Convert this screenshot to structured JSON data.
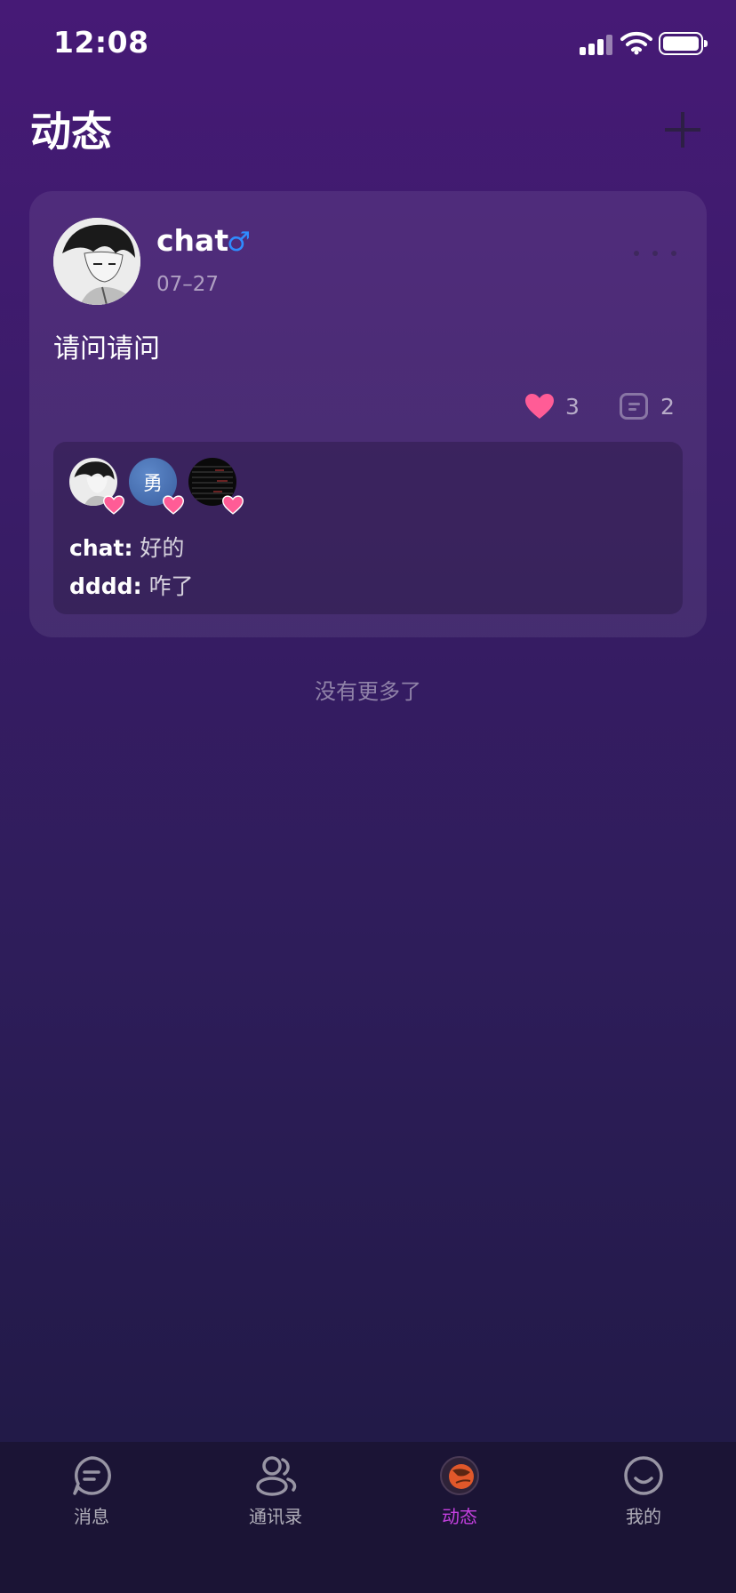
{
  "status_bar": {
    "time": "12:08"
  },
  "header": {
    "title": "动态"
  },
  "post": {
    "username": "chat",
    "gender_symbol": "♂",
    "date": "07–27",
    "content": "请问请问",
    "like_count": "3",
    "comment_count": "2",
    "likers": [
      {
        "type": "image",
        "name": "chat"
      },
      {
        "type": "text",
        "label": "勇"
      },
      {
        "type": "image",
        "name": "dark"
      }
    ],
    "comments": [
      {
        "author": "chat:",
        "text": "好的"
      },
      {
        "author": "dddd:",
        "text": "咋了"
      }
    ]
  },
  "feed": {
    "end_text": "没有更多了"
  },
  "tab_bar": {
    "tabs": [
      {
        "label": "消息",
        "icon": "message-icon",
        "active": false
      },
      {
        "label": "通讯录",
        "icon": "contacts-icon",
        "active": false
      },
      {
        "label": "动态",
        "icon": "moments-icon",
        "active": true
      },
      {
        "label": "我的",
        "icon": "profile-icon",
        "active": false
      }
    ]
  },
  "colors": {
    "accent": "#c540e0",
    "heart": "#ff5c96",
    "gender_male": "#2f8cff"
  }
}
